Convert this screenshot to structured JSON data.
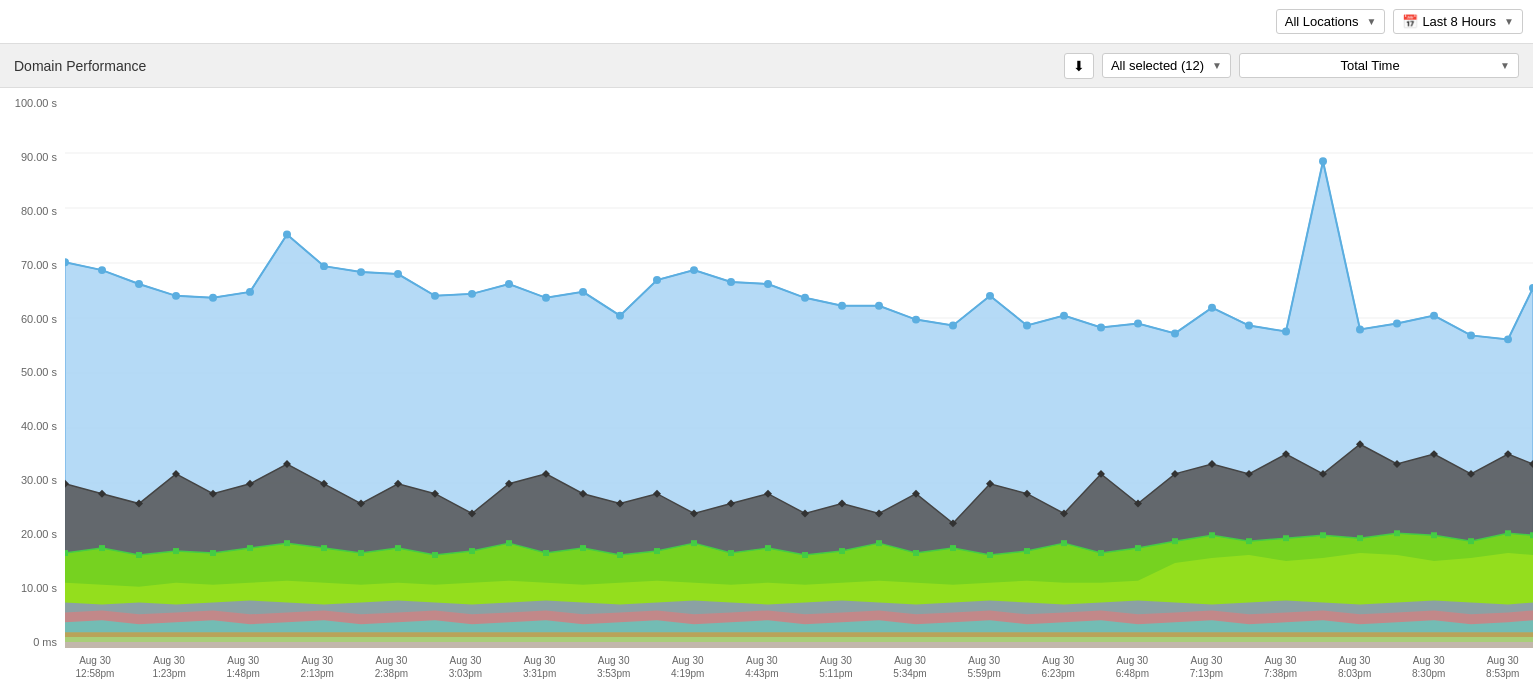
{
  "topbar": {
    "locations_label": "All Locations",
    "time_range_label": "Last 8 Hours",
    "calendar_icon": "📅"
  },
  "panel": {
    "title": "Domain Performance",
    "download_icon": "⬇",
    "domains_label": "All selected (12)",
    "metric_label": "Total Time"
  },
  "yaxis": {
    "labels": [
      "100.00 s",
      "90.00 s",
      "80.00 s",
      "70.00 s",
      "60.00 s",
      "50.00 s",
      "40.00 s",
      "30.00 s",
      "20.00 s",
      "10.00 s",
      "0 ms"
    ]
  },
  "xaxis": {
    "labels": [
      {
        "line1": "Aug 30",
        "line2": "12:58pm"
      },
      {
        "line1": "Aug 30",
        "line2": "1:23pm"
      },
      {
        "line1": "Aug 30",
        "line2": "1:48pm"
      },
      {
        "line1": "Aug 30",
        "line2": "2:13pm"
      },
      {
        "line1": "Aug 30",
        "line2": "2:38pm"
      },
      {
        "line1": "Aug 30",
        "line2": "3:03pm"
      },
      {
        "line1": "Aug 30",
        "line2": "3:31pm"
      },
      {
        "line1": "Aug 30",
        "line2": "3:53pm"
      },
      {
        "line1": "Aug 30",
        "line2": "4:19pm"
      },
      {
        "line1": "Aug 30",
        "line2": "4:43pm"
      },
      {
        "line1": "Aug 30",
        "line2": "5:11pm"
      },
      {
        "line1": "Aug 30",
        "line2": "5:34pm"
      },
      {
        "line1": "Aug 30",
        "line2": "5:59pm"
      },
      {
        "line1": "Aug 30",
        "line2": "6:23pm"
      },
      {
        "line1": "Aug 30",
        "line2": "6:48pm"
      },
      {
        "line1": "Aug 30",
        "line2": "7:13pm"
      },
      {
        "line1": "Aug 30",
        "line2": "7:38pm"
      },
      {
        "line1": "Aug 30",
        "line2": "8:03pm"
      },
      {
        "line1": "Aug 30",
        "line2": "8:30pm"
      },
      {
        "line1": "Aug 30",
        "line2": "8:53pm"
      }
    ]
  }
}
